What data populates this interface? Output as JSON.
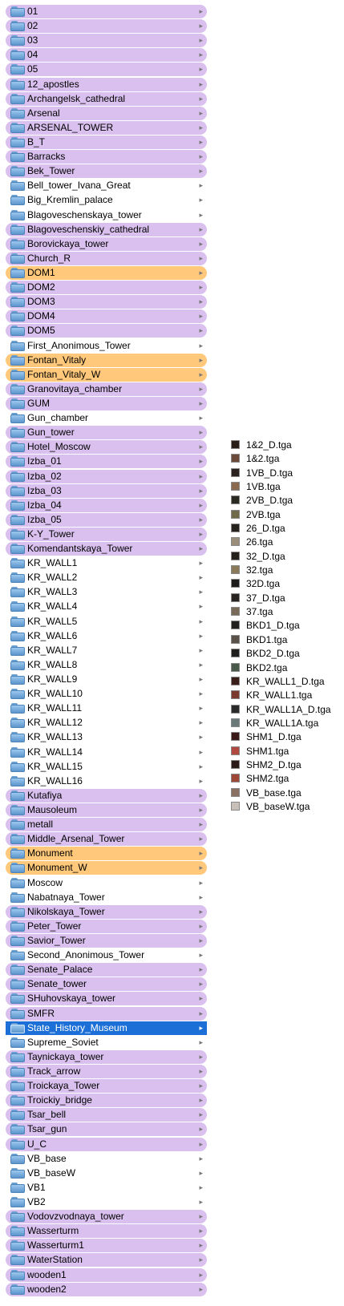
{
  "folders": [
    {
      "label": "01",
      "state": "purple"
    },
    {
      "label": "02",
      "state": "purple"
    },
    {
      "label": "03",
      "state": "purple"
    },
    {
      "label": "04",
      "state": "purple"
    },
    {
      "label": "05",
      "state": "purple"
    },
    {
      "label": "12_apostles",
      "state": "purple"
    },
    {
      "label": "Archangelsk_cathedral",
      "state": "purple"
    },
    {
      "label": "Arsenal",
      "state": "purple"
    },
    {
      "label": "ARSENAL_TOWER",
      "state": "purple"
    },
    {
      "label": "B_T",
      "state": "purple"
    },
    {
      "label": "Barracks",
      "state": "purple"
    },
    {
      "label": "Bek_Tower",
      "state": "purple"
    },
    {
      "label": "Bell_tower_Ivana_Great",
      "state": "none"
    },
    {
      "label": "Big_Kremlin_palace",
      "state": "none"
    },
    {
      "label": "Blagoveschenskaya_tower",
      "state": "none"
    },
    {
      "label": "Blagoveschenskiy_cathedral",
      "state": "purple"
    },
    {
      "label": "Borovickaya_tower",
      "state": "purple"
    },
    {
      "label": "Church_R",
      "state": "purple"
    },
    {
      "label": "DOM1",
      "state": "orange"
    },
    {
      "label": "DOM2",
      "state": "purple"
    },
    {
      "label": "DOM3",
      "state": "purple"
    },
    {
      "label": "DOM4",
      "state": "purple"
    },
    {
      "label": "DOM5",
      "state": "purple"
    },
    {
      "label": "First_Anonimous_Tower",
      "state": "none"
    },
    {
      "label": "Fontan_Vitaly",
      "state": "orange"
    },
    {
      "label": "Fontan_Vitaly_W",
      "state": "orange"
    },
    {
      "label": "Granovitaya_chamber",
      "state": "purple"
    },
    {
      "label": "GUM",
      "state": "purple"
    },
    {
      "label": "Gun_chamber",
      "state": "none"
    },
    {
      "label": "Gun_tower",
      "state": "purple"
    },
    {
      "label": "Hotel_Moscow",
      "state": "purple"
    },
    {
      "label": "Izba_01",
      "state": "purple"
    },
    {
      "label": "Izba_02",
      "state": "purple"
    },
    {
      "label": "Izba_03",
      "state": "purple"
    },
    {
      "label": "Izba_04",
      "state": "purple"
    },
    {
      "label": "Izba_05",
      "state": "purple"
    },
    {
      "label": "K-Y_Tower",
      "state": "purple"
    },
    {
      "label": "Komendantskaya_Tower",
      "state": "purple"
    },
    {
      "label": "KR_WALL1",
      "state": "none"
    },
    {
      "label": "KR_WALL2",
      "state": "none"
    },
    {
      "label": "KR_WALL3",
      "state": "none"
    },
    {
      "label": "KR_WALL4",
      "state": "none"
    },
    {
      "label": "KR_WALL5",
      "state": "none"
    },
    {
      "label": "KR_WALL6",
      "state": "none"
    },
    {
      "label": "KR_WALL7",
      "state": "none"
    },
    {
      "label": "KR_WALL8",
      "state": "none"
    },
    {
      "label": "KR_WALL9",
      "state": "none"
    },
    {
      "label": "KR_WALL10",
      "state": "none"
    },
    {
      "label": "KR_WALL11",
      "state": "none"
    },
    {
      "label": "KR_WALL12",
      "state": "none"
    },
    {
      "label": "KR_WALL13",
      "state": "none"
    },
    {
      "label": "KR_WALL14",
      "state": "none"
    },
    {
      "label": "KR_WALL15",
      "state": "none"
    },
    {
      "label": "KR_WALL16",
      "state": "none"
    },
    {
      "label": "Kutafiya",
      "state": "purple"
    },
    {
      "label": "Mausoleum",
      "state": "purple"
    },
    {
      "label": "metall",
      "state": "purple"
    },
    {
      "label": "Middle_Arsenal_Tower",
      "state": "purple"
    },
    {
      "label": "Monument",
      "state": "orange"
    },
    {
      "label": "Monument_W",
      "state": "orange"
    },
    {
      "label": "Moscow",
      "state": "none"
    },
    {
      "label": "Nabatnaya_Tower",
      "state": "none"
    },
    {
      "label": "Nikolskaya_Tower",
      "state": "purple"
    },
    {
      "label": "Peter_Tower",
      "state": "purple"
    },
    {
      "label": "Savior_Tower",
      "state": "purple"
    },
    {
      "label": "Second_Anonimous_Tower",
      "state": "none"
    },
    {
      "label": "Senate_Palace",
      "state": "purple"
    },
    {
      "label": "Senate_tower",
      "state": "purple"
    },
    {
      "label": "SHuhovskaya_tower",
      "state": "purple"
    },
    {
      "label": "SMFR",
      "state": "purple"
    },
    {
      "label": "State_History_Museum",
      "state": "selected"
    },
    {
      "label": "Supreme_Soviet",
      "state": "none"
    },
    {
      "label": "Taynickaya_tower",
      "state": "purple"
    },
    {
      "label": "Track_arrow",
      "state": "purple"
    },
    {
      "label": "Troickaya_Tower",
      "state": "purple"
    },
    {
      "label": "Troickiy_bridge",
      "state": "purple"
    },
    {
      "label": "Tsar_bell",
      "state": "purple"
    },
    {
      "label": "Tsar_gun",
      "state": "purple"
    },
    {
      "label": "U_C",
      "state": "purple"
    },
    {
      "label": "VB_base",
      "state": "none"
    },
    {
      "label": "VB_baseW",
      "state": "none"
    },
    {
      "label": "VB1",
      "state": "none"
    },
    {
      "label": "VB2",
      "state": "none"
    },
    {
      "label": "Vodovzvodnaya_tower",
      "state": "purple"
    },
    {
      "label": "Wasserturm",
      "state": "purple"
    },
    {
      "label": "Wasserturm1",
      "state": "purple"
    },
    {
      "label": "WaterStation",
      "state": "purple"
    },
    {
      "label": "wooden1",
      "state": "purple"
    },
    {
      "label": "wooden2",
      "state": "purple"
    }
  ],
  "files": [
    {
      "label": "1&2_D.tga",
      "swatch": "#2a1e18"
    },
    {
      "label": "1&2.tga",
      "swatch": "#6b4a3a"
    },
    {
      "label": "1VB_D.tga",
      "swatch": "#2b2220"
    },
    {
      "label": "1VB.tga",
      "swatch": "#8a6a4e"
    },
    {
      "label": "2VB_D.tga",
      "swatch": "#2a2a22"
    },
    {
      "label": "2VB.tga",
      "swatch": "#6e6a4a"
    },
    {
      "label": "26_D.tga",
      "swatch": "#26221e"
    },
    {
      "label": "26.tga",
      "swatch": "#9a8e7a"
    },
    {
      "label": "32_D.tga",
      "swatch": "#24201c"
    },
    {
      "label": "32.tga",
      "swatch": "#8a7a5a"
    },
    {
      "label": "32D.tga",
      "swatch": "#1e1c1a"
    },
    {
      "label": "37_D.tga",
      "swatch": "#2a2420"
    },
    {
      "label": "37.tga",
      "swatch": "#7a6a5a"
    },
    {
      "label": "BKD1_D.tga",
      "swatch": "#22201e"
    },
    {
      "label": "BKD1.tga",
      "swatch": "#5a5248"
    },
    {
      "label": "BKD2_D.tga",
      "swatch": "#201e1c"
    },
    {
      "label": "BKD2.tga",
      "swatch": "#4a5a4a"
    },
    {
      "label": "KR_WALL1_D.tga",
      "swatch": "#3a1e1a"
    },
    {
      "label": "KR_WALL1.tga",
      "swatch": "#7a3a30"
    },
    {
      "label": "KR_WALL1A_D.tga",
      "swatch": "#2a2a2a"
    },
    {
      "label": "KR_WALL1A.tga",
      "swatch": "#6a7a78"
    },
    {
      "label": "SHM1_D.tga",
      "swatch": "#3a1a18"
    },
    {
      "label": "SHM1.tga",
      "swatch": "#b04a40"
    },
    {
      "label": "SHM2_D.tga",
      "swatch": "#2a1a18"
    },
    {
      "label": "SHM2.tga",
      "swatch": "#a04838"
    },
    {
      "label": "VB_base.tga",
      "swatch": "#8a7060"
    },
    {
      "label": "VB_baseW.tga",
      "swatch": "#c8c0b8"
    }
  ],
  "icons": {
    "folder": "folder-icon",
    "disclosure": "disclosure-arrow-icon",
    "arrow_glyph": "▸"
  }
}
